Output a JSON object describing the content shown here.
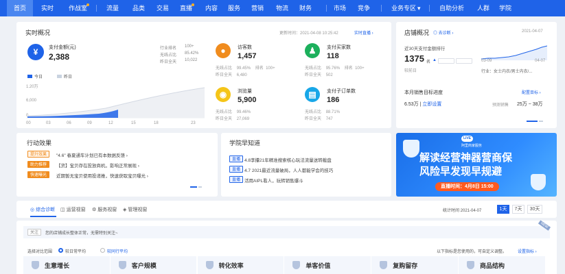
{
  "nav": {
    "items": [
      {
        "label": "首页",
        "active": true,
        "dot": false
      },
      {
        "label": "实时",
        "active": false,
        "dot": false
      },
      {
        "label": "作战室",
        "active": false,
        "dot": true
      },
      {
        "label": "流量",
        "active": false,
        "dot": false
      },
      {
        "label": "品类",
        "active": false,
        "dot": false
      },
      {
        "label": "交易",
        "active": false,
        "dot": false
      },
      {
        "label": "直播",
        "active": false,
        "dot": true
      },
      {
        "label": "内容",
        "active": false,
        "dot": false
      },
      {
        "label": "服务",
        "active": false,
        "dot": false
      },
      {
        "label": "营销",
        "active": false,
        "dot": false
      },
      {
        "label": "物流",
        "active": false,
        "dot": false
      },
      {
        "label": "财务",
        "active": false,
        "dot": false
      },
      {
        "label": "市场",
        "active": false,
        "dot": false
      },
      {
        "label": "竞争",
        "active": false,
        "dot": false
      },
      {
        "label": "业务专区",
        "active": false,
        "dot": false,
        "caret": "▾"
      },
      {
        "label": "自助分析",
        "active": false,
        "dot": false
      },
      {
        "label": "人群",
        "active": false,
        "dot": false
      },
      {
        "label": "学院",
        "active": false,
        "dot": false
      }
    ]
  },
  "realtime": {
    "title": "实时概况",
    "update_time": "更新时间：2021-04-08 10:25:42",
    "live_link": "实时直播 ›",
    "pay": {
      "label": "支付金额(元)",
      "value": "2,388",
      "industry_rank_label": "行业排名",
      "industry_rank_value": "100+",
      "ratio_label": "无线占比",
      "ratio_value": "85.42%",
      "yesterday_label": "昨日全天",
      "yesterday_value": "10,022"
    },
    "legend_today": "今日",
    "legend_yesterday": "昨日",
    "y_ticks": [
      "1.20万",
      "6,000",
      "0"
    ],
    "x_ticks": [
      "00",
      "03",
      "06",
      "09",
      "12",
      "15",
      "18",
      "23"
    ],
    "visitors": {
      "label": "访客数",
      "value": "1,457",
      "ratio_label": "无线占比",
      "ratio_value": "99.45%",
      "rank_label": "排名",
      "rank_value": "100+",
      "yesterday_label": "昨日全天",
      "yesterday_value": "6,480"
    },
    "buyers": {
      "label": "支付买家数",
      "value": "118",
      "ratio_label": "无线占比",
      "ratio_value": "95.76%",
      "rank_label": "排名",
      "rank_value": "100+",
      "yesterday_label": "昨日全天",
      "yesterday_value": "502"
    },
    "views": {
      "label": "浏览量",
      "value": "5,900",
      "ratio_label": "无线占比",
      "ratio_value": "99.46%",
      "yesterday_label": "昨日全天",
      "yesterday_value": "27,069"
    },
    "orders": {
      "label": "支付子订单数",
      "value": "186",
      "ratio_label": "无线占比",
      "ratio_value": "88.71%",
      "yesterday_label": "昨日全天",
      "yesterday_value": "747"
    }
  },
  "shop": {
    "title": "店铺概况",
    "diagnose_link": "◎ 去诊断 ›",
    "date": "2021-04-07",
    "rank_label": "近30天支付金额排行",
    "rank_value": "1375",
    "rank_unit": "名",
    "compare_label": "较前日",
    "x_start": "03-09",
    "x_end": "04-07",
    "industry": "行业：女士内衣/男士内衣/...",
    "target_title": "本月销售目标进度",
    "target_link": "配置目标 ›",
    "amount": "6.53万",
    "set_link": "立即设置",
    "forecast_label": "预测销售",
    "forecast_value": "25万 ~ 38万"
  },
  "action": {
    "title": "行动效果",
    "items": [
      {
        "tag": "提升效果",
        "text": "\"4.6\" 春夏通车计划已有本数据反馈 ›"
      },
      {
        "tag": "助力推荐",
        "text": "【货】宝贝存在投放商机，影响正常展现 ›"
      },
      {
        "tag": "快速曝光",
        "text": "近期暂无宝贝使用投递推，快速获取宝贝曝光 ›"
      }
    ]
  },
  "academy": {
    "title": "学院早知道",
    "items": [
      {
        "tag": "直播",
        "text": "4.8李攥21年精准搜索核心玩法流量送转截盘"
      },
      {
        "tag": "直播",
        "text": "4.7 2021最近流量破局，人人都能学会的技巧"
      },
      {
        "tag": "直播",
        "text": "活用AIPL看人，玩转销售爆斗"
      }
    ]
  },
  "banner": {
    "badge": "LIVE",
    "brand": "阿里商家服务",
    "line1": "解读经营神器营商保",
    "line2": "风险早发现早规避",
    "cta": "直播时间：4月8日 15:00",
    "colors": {
      "bg": "#1a6ee8",
      "cta": "#ff5a1f"
    }
  },
  "diagnosis": {
    "tabs": [
      {
        "label": "综合诊断",
        "icon": "◎"
      },
      {
        "label": "运营视窗",
        "icon": "◫"
      },
      {
        "label": "服务视窗",
        "icon": "⚙"
      },
      {
        "label": "管理视窗",
        "icon": "◈"
      }
    ],
    "stat_time": "统计时间 2021-04-07",
    "periods": [
      "1天",
      "7天",
      "30天"
    ],
    "notice_tag": "关注",
    "notice_text": "您的店铺成长整体正常，无需特别关注~",
    "compare_label": "选择对比范围",
    "radio1": "较日常平均",
    "radio2": "较同行平均",
    "note": "以下指标是您使用的，可自定义调整。",
    "settings_link": "设置指标 ›",
    "new_badge": "NEW",
    "metrics": [
      "生意增长",
      "客户规模",
      "转化效率",
      "单客价值",
      "复购留存",
      "商品结构"
    ]
  }
}
